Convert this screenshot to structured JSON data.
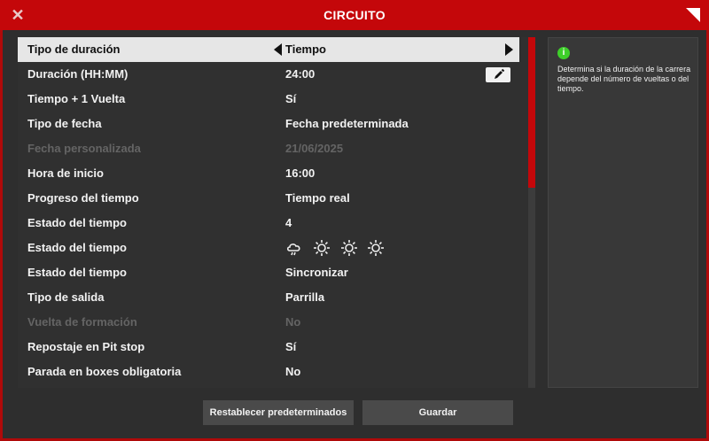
{
  "window": {
    "title": "CIRCUITO",
    "close_icon": "close-icon",
    "corner_icon": "corner-triangle-icon",
    "accent_color": "#c4070a"
  },
  "settings": [
    {
      "label": "Tipo de duración",
      "value": "Tiempo",
      "state": "selected"
    },
    {
      "label": "Duración (HH:MM)",
      "value": "24:00",
      "state": "normal"
    },
    {
      "label": "Tiempo + 1 Vuelta",
      "value": "Sí",
      "state": "normal"
    },
    {
      "label": "Tipo de fecha",
      "value": "Fecha predeterminada",
      "state": "normal"
    },
    {
      "label": "Fecha personalizada",
      "value": "21/06/2025",
      "state": "disabled"
    },
    {
      "label": "Hora de inicio",
      "value": "16:00",
      "state": "normal"
    },
    {
      "label": "Progreso del tiempo",
      "value": "Tiempo real",
      "state": "normal"
    },
    {
      "label": "Estado del tiempo",
      "value": "4",
      "state": "normal"
    },
    {
      "label": "Estado del tiempo",
      "value": "",
      "state": "normal",
      "icons": [
        "cloud-rain-icon",
        "sun-icon",
        "sun-icon",
        "sun-icon"
      ]
    },
    {
      "label": "Estado del tiempo",
      "value": "Sincronizar",
      "state": "normal"
    },
    {
      "label": "Tipo de salida",
      "value": "Parrilla",
      "state": "normal"
    },
    {
      "label": "Vuelta de formación",
      "value": "No",
      "state": "disabled"
    },
    {
      "label": "Repostaje en Pit stop",
      "value": "Sí",
      "state": "normal"
    },
    {
      "label": "Parada en boxes obligatoria",
      "value": "No",
      "state": "normal"
    }
  ],
  "edit_icon": "pencil-icon",
  "info": {
    "icon": "info-icon",
    "icon_glyph": "i",
    "text": "Determina si la duración de la carrera depende del número de vueltas o del tiempo.",
    "icon_color": "#3ecf2a"
  },
  "buttons": {
    "reset_label": "Restablecer predeterminados",
    "save_label": "Guardar"
  }
}
